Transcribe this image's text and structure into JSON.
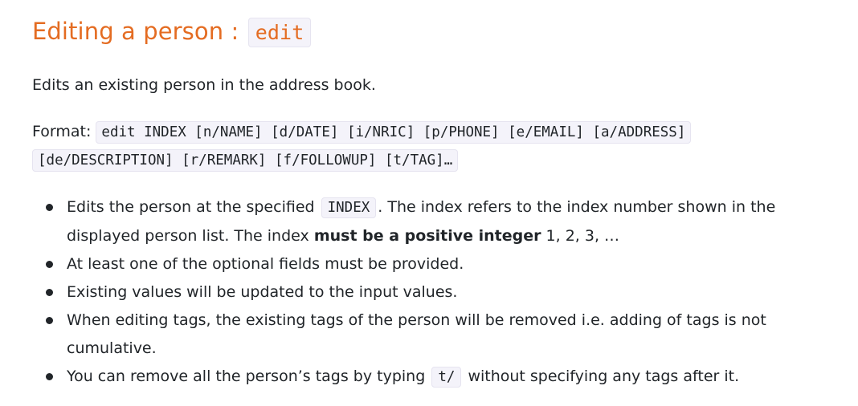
{
  "heading": {
    "text": "Editing a person : ",
    "command": "edit"
  },
  "description": "Edits an existing person in the address book.",
  "format": {
    "label": "Format: ",
    "part1": "edit INDEX [n/NAME] [d/DATE] [i/NRIC] [p/PHONE] [e/EMAIL] [a/ADDRESS]",
    "part2": "[de/DESCRIPTION] [r/REMARK] [f/FOLLOWUP] [t/TAG]…"
  },
  "bullets": {
    "b1": {
      "pre": "Edits the person at the specified ",
      "code": "INDEX",
      "mid": ". The index refers to the index number shown in the displayed person list. The index ",
      "bold": "must be a positive integer",
      "post": " 1, 2, 3, …"
    },
    "b2": "At least one of the optional fields must be provided.",
    "b3": "Existing values will be updated to the input values.",
    "b4": "When editing tags, the existing tags of the person will be removed i.e. adding of tags is not cumulative.",
    "b5": {
      "pre": "You can remove all the person’s tags by typing ",
      "code": "t/",
      "post": " without specifying any tags after it."
    }
  },
  "colors": {
    "heading": "#e46c22",
    "text": "#212529",
    "code_background": "#f4f3fa"
  }
}
